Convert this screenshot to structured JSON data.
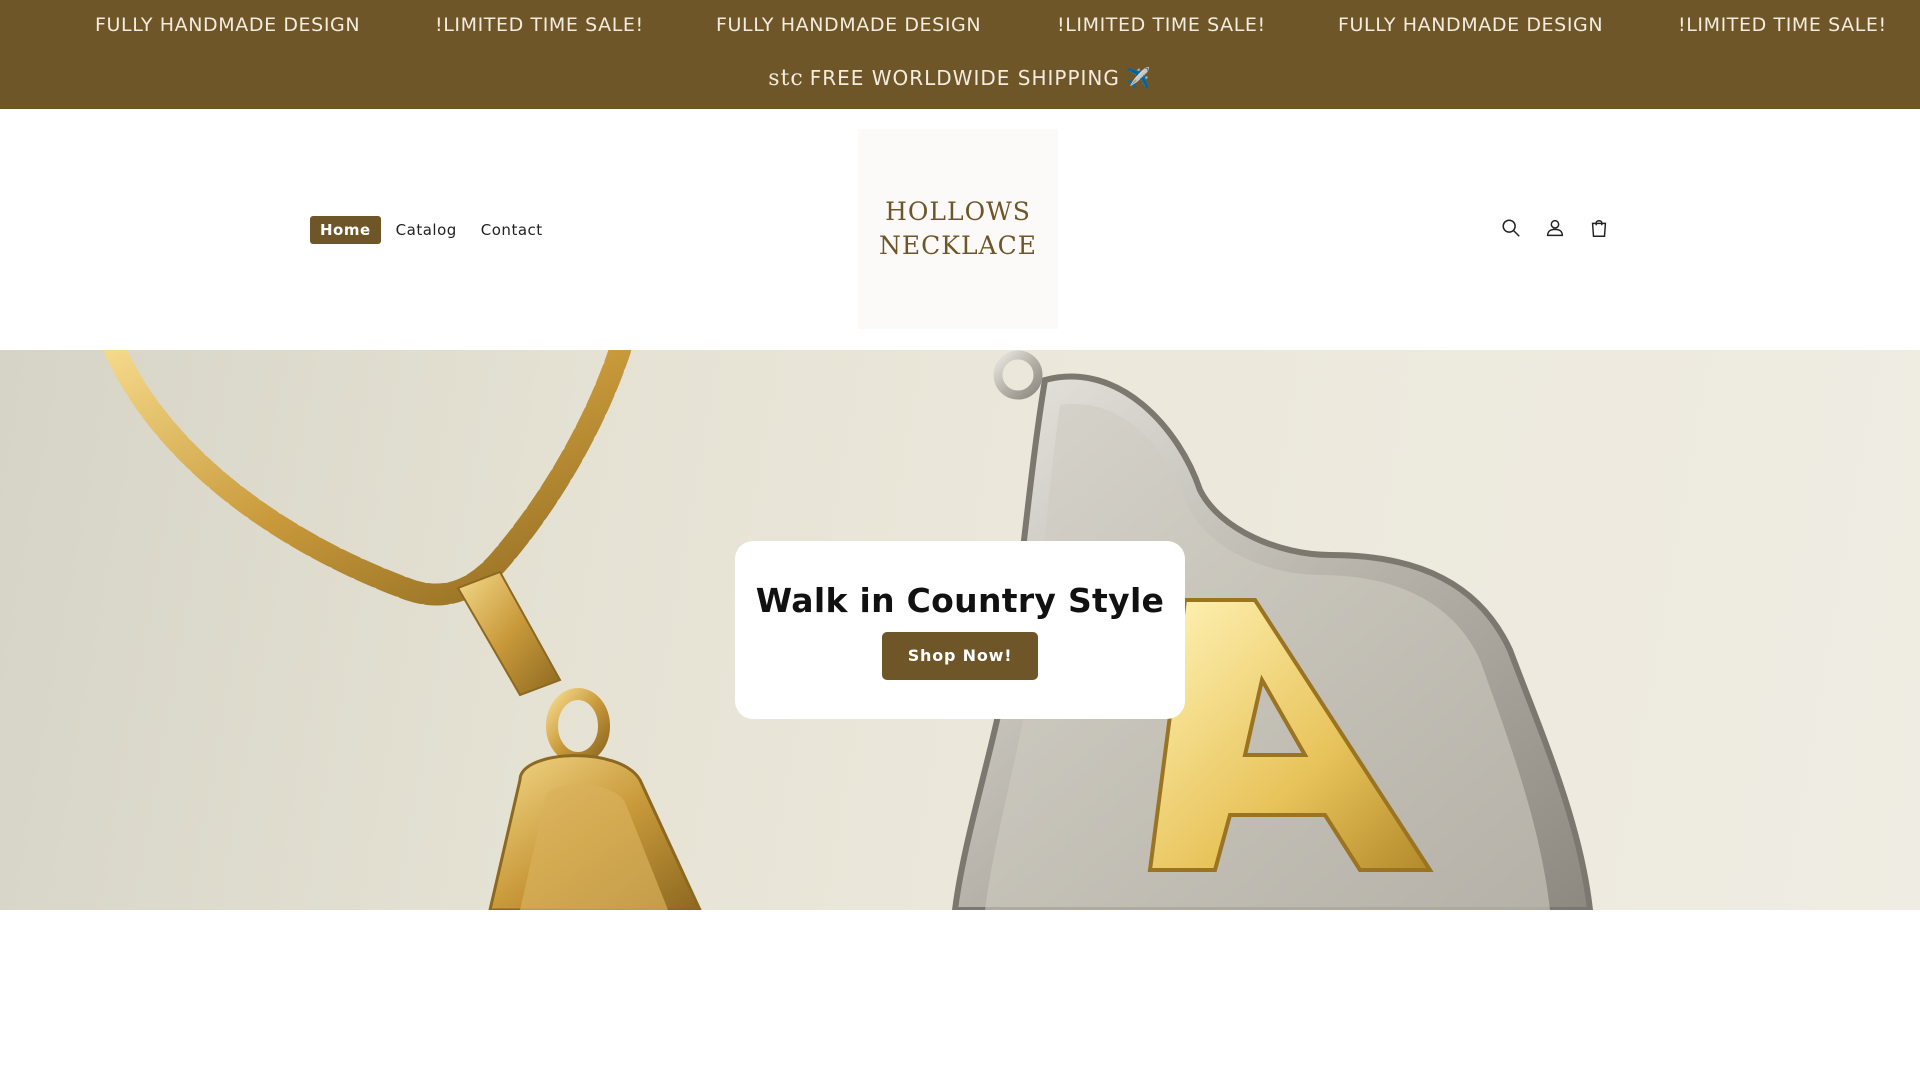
{
  "announcement": {
    "marquee": [
      "FULLY HANDMADE DESIGN",
      "!LIMITED TIME SALE!",
      "FULLY HANDMADE DESIGN",
      "!LIMITED TIME SALE!",
      "FULLY HANDMADE DESIGN",
      "!LIMITED TIME SALE!"
    ],
    "shipping_prefix": "stc",
    "shipping_text": "FREE WORLDWIDE SHIPPING",
    "shipping_emoji": "✈️"
  },
  "header": {
    "nav": [
      {
        "label": "Home",
        "active": true
      },
      {
        "label": "Catalog",
        "active": false
      },
      {
        "label": "Contact",
        "active": false
      }
    ],
    "logo": {
      "line1": "HOLLOWS",
      "line2": "NECKLACE"
    },
    "icons": [
      "search-icon",
      "account-icon",
      "cart-icon"
    ]
  },
  "hero": {
    "title": "Walk in Country Style",
    "button_label": "Shop Now!"
  },
  "colors": {
    "brand": "#6e5629",
    "announcement_text": "#f3ecde",
    "background": "#ffffff"
  }
}
